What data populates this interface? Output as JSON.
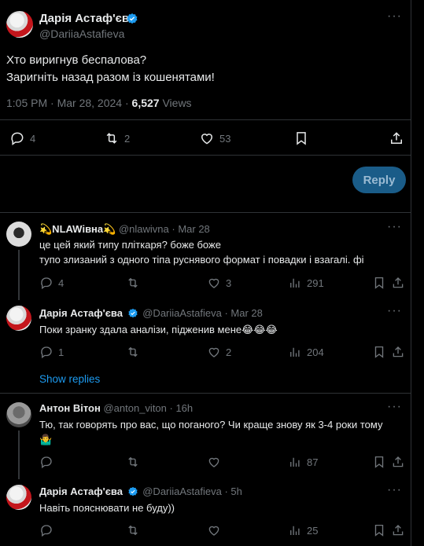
{
  "main_tweet": {
    "author": "Дарія Астаф'єва",
    "handle": "@DariiaAstafieva",
    "line1": "Хто виригнув беспалова?",
    "line2": "Заригніть назад разом із кошенятами!",
    "time": "1:05 PM · Mar 28, 2024 ·",
    "views_count": "6,527",
    "views_label": "Views",
    "replies": "4",
    "reposts": "2",
    "likes": "53"
  },
  "composer": {
    "reply_label": "Reply"
  },
  "replies": [
    {
      "author": "💫NLAWівна💫",
      "handle": "@nlawivna",
      "date": "· Mar 28",
      "line1": "це цей який типу пліткаря? боже боже",
      "line2": "тупо злизаний з одного тіпа руснявого формат і повадки і взагалі. фі",
      "replies": "4",
      "likes": "3",
      "views": "291"
    },
    {
      "author": "Дарія Астаф'єва",
      "handle": "@DariiaAstafieva",
      "date": "· Mar 28",
      "line1": "Поки зранку здала аналізи, підженив мене😂😂😂",
      "replies": "1",
      "likes": "2",
      "views": "204"
    },
    {
      "author": "Антон Вітон",
      "handle": "@anton_viton",
      "date": "· 16h",
      "line1": "Тю, так говорять про вас, що поганого? Чи краще знову як 3-4 роки тому",
      "line2": "🤷‍♂️",
      "views": "87"
    },
    {
      "author": "Дарія Астаф'єва",
      "handle": "@DariiaAstafieva",
      "date": "· 5h",
      "line1": "Навіть пояснювати не буду))",
      "views": "25"
    }
  ],
  "show_replies_label": "Show replies",
  "colors": {
    "accent": "#1d9bf0",
    "muted": "#71767b",
    "text": "#e7e9ea",
    "border": "#2f3336"
  }
}
